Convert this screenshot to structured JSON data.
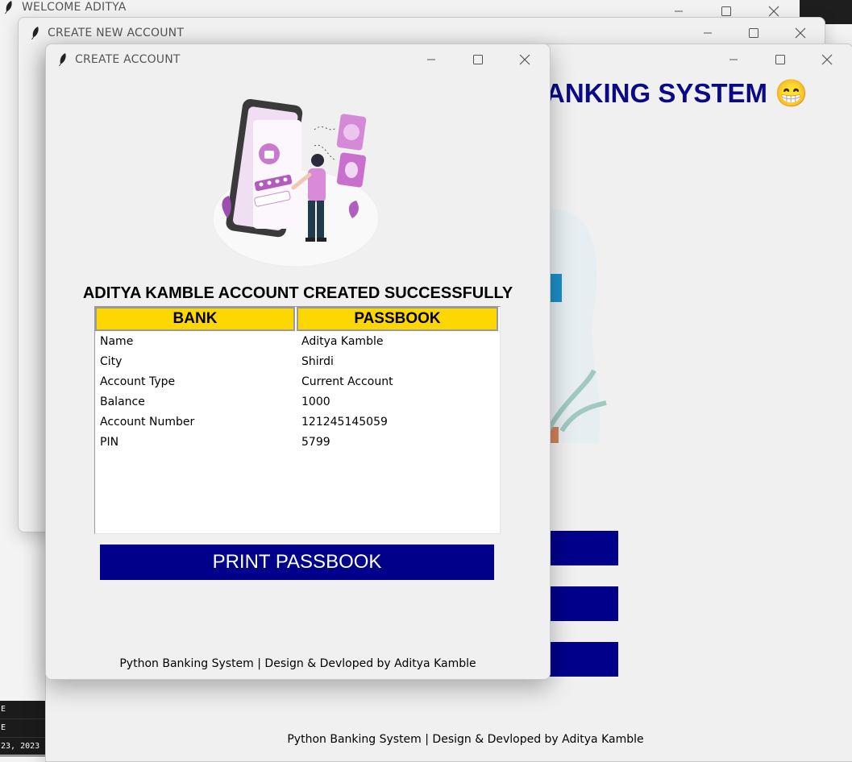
{
  "windows": {
    "welcome": {
      "title": "WELCOME ADITYA"
    },
    "create_new": {
      "title": "CREATE NEW ACCOUNT"
    },
    "create_account": {
      "title": "CREATE ACCOUNT"
    }
  },
  "main": {
    "heading": "ANKING SYSTEM 😁",
    "footer": "Python Banking System | Design & Devloped by Aditya Kamble"
  },
  "account": {
    "success_message": "ADITYA KAMBLE ACCOUNT CREATED SUCCESSFULLY",
    "columns": [
      "BANK",
      "PASSBOOK"
    ],
    "rows": [
      {
        "label": "Name",
        "value": "Aditya Kamble"
      },
      {
        "label": "City",
        "value": "Shirdi"
      },
      {
        "label": "Account Type",
        "value": "Current Account"
      },
      {
        "label": "Balance",
        "value": "1000"
      },
      {
        "label": "Account Number",
        "value": "121245145059"
      },
      {
        "label": "PIN",
        "value": "5799"
      }
    ],
    "print_button": "PRINT PASSBOOK",
    "footer": "Python Banking System | Design & Devloped by Aditya Kamble"
  },
  "taskbar_fragments": [
    "E",
    "E",
    "23, 2023"
  ],
  "colors": {
    "accent": "#00008b",
    "header_yellow": "#ffd700",
    "heading_blue": "#0a0a86"
  }
}
